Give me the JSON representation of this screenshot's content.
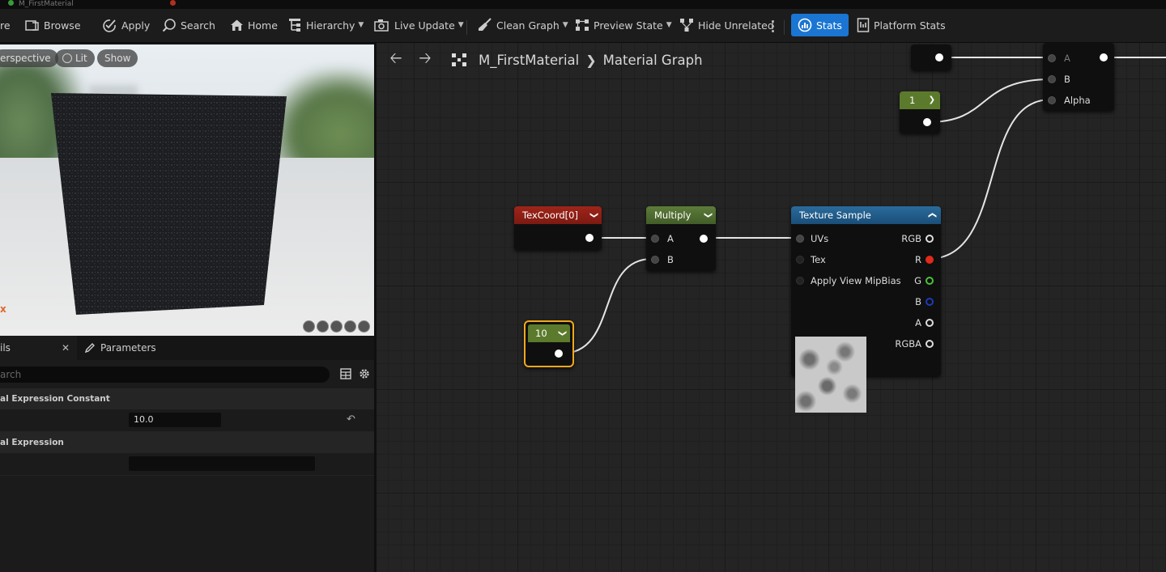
{
  "colors": {
    "accent": "#1a76d2",
    "constant_header": "#5c7a2c",
    "texcoord_header": "#8c1d14",
    "multiply_header": "#4f6a32",
    "texsample_header": "#1e5b8a",
    "selection": "#f2a81d"
  },
  "tabs": [
    "M_FirstMaterial"
  ],
  "toolbar": {
    "items": [
      {
        "label": "re",
        "icon": "unknown-icon"
      },
      {
        "label": "Browse",
        "icon": "folder-icon"
      },
      {
        "label": "Apply",
        "icon": "checkmark-icon"
      },
      {
        "label": "Search",
        "icon": "search-icon"
      },
      {
        "label": "Home",
        "icon": "home-icon"
      },
      {
        "label": "Hierarchy",
        "icon": "hierarchy-icon"
      },
      {
        "label": "Live Update",
        "icon": "live-update-icon"
      },
      {
        "label": "Clean Graph",
        "icon": "broom-icon"
      },
      {
        "label": "Preview State",
        "icon": "preview-state-icon"
      },
      {
        "label": "Hide Unrelated",
        "icon": "hide-unrelated-icon"
      },
      {
        "label": "Stats",
        "icon": "stats-icon"
      },
      {
        "label": "Platform Stats",
        "icon": "platform-stats-icon"
      }
    ]
  },
  "viewport": {
    "buttons": [
      "erspective",
      "Lit",
      "Show"
    ],
    "axis_label": "x"
  },
  "details": {
    "tab_details": "ils",
    "tab_parameters": "Parameters",
    "search_placeholder": "arch",
    "sections": [
      {
        "title": "al Expression Constant",
        "value": "10.0"
      },
      {
        "title": "al Expression",
        "value": ""
      }
    ]
  },
  "graph": {
    "breadcrumb_asset": "M_FirstMaterial",
    "breadcrumb_graph": "Material Graph",
    "nodes": {
      "texcoord": {
        "title": "TexCoord[0]"
      },
      "multiply": {
        "title": "Multiply",
        "pin_a": "A",
        "pin_b": "B"
      },
      "constant_10": {
        "value": "10"
      },
      "constant_1": {
        "value": "1"
      },
      "texture_sample": {
        "title": "Texture Sample",
        "inputs": [
          "UVs",
          "Tex",
          "Apply View MipBias"
        ],
        "outputs": [
          "RGB",
          "R",
          "G",
          "B",
          "A",
          "RGBA"
        ]
      },
      "lerp": {
        "pin_a": "A",
        "pin_b": "B",
        "pin_alpha": "Alpha"
      }
    }
  }
}
